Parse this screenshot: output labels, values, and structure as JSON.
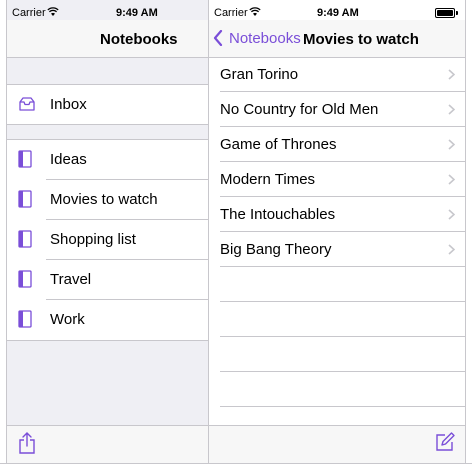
{
  "accent_color": "#7a4ed8",
  "left_screen": {
    "status": {
      "carrier": "Carrier",
      "time": "9:49 AM"
    },
    "nav": {
      "title": "Notebooks"
    },
    "inbox": {
      "label": "Inbox",
      "icon": "inbox-tray-icon"
    },
    "notebooks": [
      {
        "label": "Ideas",
        "icon": "notebook-icon"
      },
      {
        "label": "Movies to watch",
        "icon": "notebook-icon"
      },
      {
        "label": "Shopping list",
        "icon": "notebook-icon"
      },
      {
        "label": "Travel",
        "icon": "notebook-icon"
      },
      {
        "label": "Work",
        "icon": "notebook-icon"
      }
    ],
    "toolbar": {
      "icon": "share-icon"
    }
  },
  "right_screen": {
    "status": {
      "carrier": "Carrier",
      "time": "9:49 AM"
    },
    "nav": {
      "back_label": "Notebooks",
      "title": "Movies to watch"
    },
    "movies": [
      {
        "title": "Gran Torino"
      },
      {
        "title": "No Country for Old Men"
      },
      {
        "title": "Game of Thrones"
      },
      {
        "title": "Modern Times"
      },
      {
        "title": "The Intouchables"
      },
      {
        "title": "Big Bang Theory"
      }
    ],
    "toolbar": {
      "icon": "compose-icon"
    }
  }
}
